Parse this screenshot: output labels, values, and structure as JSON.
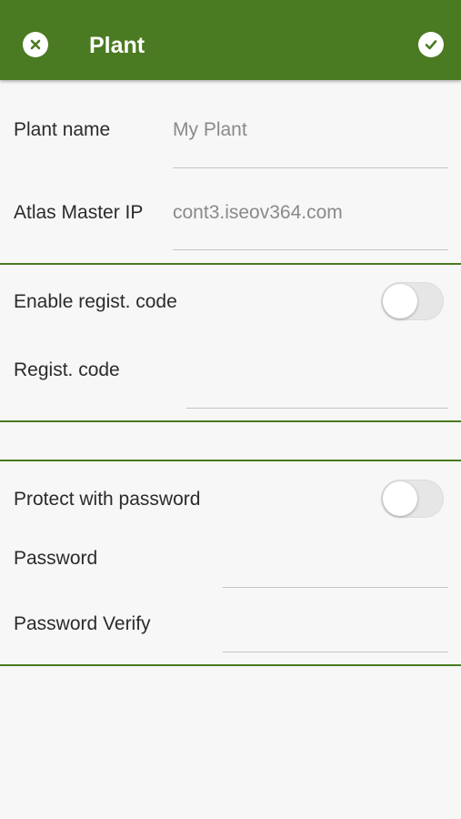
{
  "header": {
    "title": "Plant",
    "close_icon": "close-circle-icon",
    "confirm_icon": "check-circle-icon",
    "bar_color": "#4a7a21"
  },
  "plant_section": {
    "name_label": "Plant name",
    "name_value": "My Plant",
    "ip_label": "Atlas Master IP",
    "ip_value": "cont3.iseov364.com"
  },
  "registration_section": {
    "enable_label": "Enable regist. code",
    "enable_on": false,
    "code_label": "Regist. code",
    "code_value": ""
  },
  "password_section": {
    "protect_label": "Protect with password",
    "protect_on": false,
    "password_label": "Password",
    "password_value": "",
    "verify_label": "Password Verify",
    "verify_value": ""
  }
}
